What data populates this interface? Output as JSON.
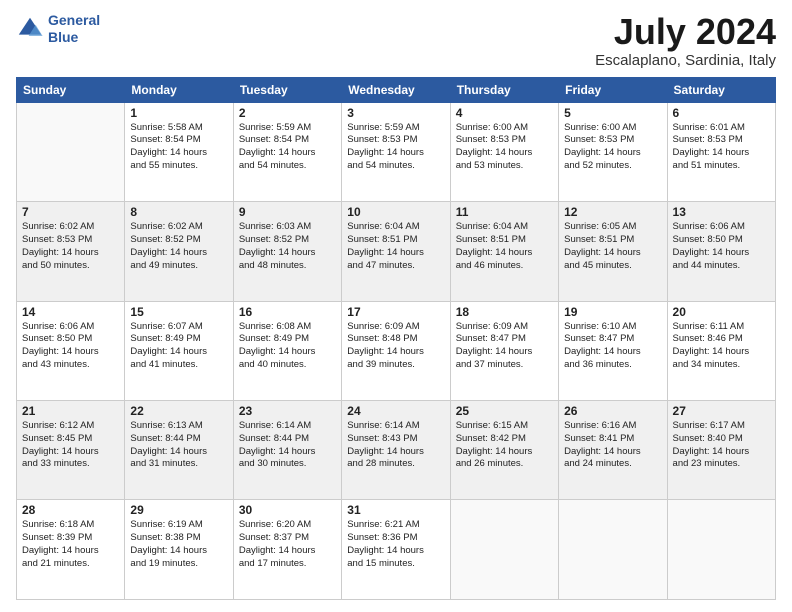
{
  "logo": {
    "line1": "General",
    "line2": "Blue"
  },
  "title": "July 2024",
  "location": "Escalaplano, Sardinia, Italy",
  "headers": [
    "Sunday",
    "Monday",
    "Tuesday",
    "Wednesday",
    "Thursday",
    "Friday",
    "Saturday"
  ],
  "weeks": [
    [
      {
        "day": "",
        "lines": []
      },
      {
        "day": "1",
        "lines": [
          "Sunrise: 5:58 AM",
          "Sunset: 8:54 PM",
          "Daylight: 14 hours",
          "and 55 minutes."
        ]
      },
      {
        "day": "2",
        "lines": [
          "Sunrise: 5:59 AM",
          "Sunset: 8:54 PM",
          "Daylight: 14 hours",
          "and 54 minutes."
        ]
      },
      {
        "day": "3",
        "lines": [
          "Sunrise: 5:59 AM",
          "Sunset: 8:53 PM",
          "Daylight: 14 hours",
          "and 54 minutes."
        ]
      },
      {
        "day": "4",
        "lines": [
          "Sunrise: 6:00 AM",
          "Sunset: 8:53 PM",
          "Daylight: 14 hours",
          "and 53 minutes."
        ]
      },
      {
        "day": "5",
        "lines": [
          "Sunrise: 6:00 AM",
          "Sunset: 8:53 PM",
          "Daylight: 14 hours",
          "and 52 minutes."
        ]
      },
      {
        "day": "6",
        "lines": [
          "Sunrise: 6:01 AM",
          "Sunset: 8:53 PM",
          "Daylight: 14 hours",
          "and 51 minutes."
        ]
      }
    ],
    [
      {
        "day": "7",
        "lines": [
          "Sunrise: 6:02 AM",
          "Sunset: 8:53 PM",
          "Daylight: 14 hours",
          "and 50 minutes."
        ]
      },
      {
        "day": "8",
        "lines": [
          "Sunrise: 6:02 AM",
          "Sunset: 8:52 PM",
          "Daylight: 14 hours",
          "and 49 minutes."
        ]
      },
      {
        "day": "9",
        "lines": [
          "Sunrise: 6:03 AM",
          "Sunset: 8:52 PM",
          "Daylight: 14 hours",
          "and 48 minutes."
        ]
      },
      {
        "day": "10",
        "lines": [
          "Sunrise: 6:04 AM",
          "Sunset: 8:51 PM",
          "Daylight: 14 hours",
          "and 47 minutes."
        ]
      },
      {
        "day": "11",
        "lines": [
          "Sunrise: 6:04 AM",
          "Sunset: 8:51 PM",
          "Daylight: 14 hours",
          "and 46 minutes."
        ]
      },
      {
        "day": "12",
        "lines": [
          "Sunrise: 6:05 AM",
          "Sunset: 8:51 PM",
          "Daylight: 14 hours",
          "and 45 minutes."
        ]
      },
      {
        "day": "13",
        "lines": [
          "Sunrise: 6:06 AM",
          "Sunset: 8:50 PM",
          "Daylight: 14 hours",
          "and 44 minutes."
        ]
      }
    ],
    [
      {
        "day": "14",
        "lines": [
          "Sunrise: 6:06 AM",
          "Sunset: 8:50 PM",
          "Daylight: 14 hours",
          "and 43 minutes."
        ]
      },
      {
        "day": "15",
        "lines": [
          "Sunrise: 6:07 AM",
          "Sunset: 8:49 PM",
          "Daylight: 14 hours",
          "and 41 minutes."
        ]
      },
      {
        "day": "16",
        "lines": [
          "Sunrise: 6:08 AM",
          "Sunset: 8:49 PM",
          "Daylight: 14 hours",
          "and 40 minutes."
        ]
      },
      {
        "day": "17",
        "lines": [
          "Sunrise: 6:09 AM",
          "Sunset: 8:48 PM",
          "Daylight: 14 hours",
          "and 39 minutes."
        ]
      },
      {
        "day": "18",
        "lines": [
          "Sunrise: 6:09 AM",
          "Sunset: 8:47 PM",
          "Daylight: 14 hours",
          "and 37 minutes."
        ]
      },
      {
        "day": "19",
        "lines": [
          "Sunrise: 6:10 AM",
          "Sunset: 8:47 PM",
          "Daylight: 14 hours",
          "and 36 minutes."
        ]
      },
      {
        "day": "20",
        "lines": [
          "Sunrise: 6:11 AM",
          "Sunset: 8:46 PM",
          "Daylight: 14 hours",
          "and 34 minutes."
        ]
      }
    ],
    [
      {
        "day": "21",
        "lines": [
          "Sunrise: 6:12 AM",
          "Sunset: 8:45 PM",
          "Daylight: 14 hours",
          "and 33 minutes."
        ]
      },
      {
        "day": "22",
        "lines": [
          "Sunrise: 6:13 AM",
          "Sunset: 8:44 PM",
          "Daylight: 14 hours",
          "and 31 minutes."
        ]
      },
      {
        "day": "23",
        "lines": [
          "Sunrise: 6:14 AM",
          "Sunset: 8:44 PM",
          "Daylight: 14 hours",
          "and 30 minutes."
        ]
      },
      {
        "day": "24",
        "lines": [
          "Sunrise: 6:14 AM",
          "Sunset: 8:43 PM",
          "Daylight: 14 hours",
          "and 28 minutes."
        ]
      },
      {
        "day": "25",
        "lines": [
          "Sunrise: 6:15 AM",
          "Sunset: 8:42 PM",
          "Daylight: 14 hours",
          "and 26 minutes."
        ]
      },
      {
        "day": "26",
        "lines": [
          "Sunrise: 6:16 AM",
          "Sunset: 8:41 PM",
          "Daylight: 14 hours",
          "and 24 minutes."
        ]
      },
      {
        "day": "27",
        "lines": [
          "Sunrise: 6:17 AM",
          "Sunset: 8:40 PM",
          "Daylight: 14 hours",
          "and 23 minutes."
        ]
      }
    ],
    [
      {
        "day": "28",
        "lines": [
          "Sunrise: 6:18 AM",
          "Sunset: 8:39 PM",
          "Daylight: 14 hours",
          "and 21 minutes."
        ]
      },
      {
        "day": "29",
        "lines": [
          "Sunrise: 6:19 AM",
          "Sunset: 8:38 PM",
          "Daylight: 14 hours",
          "and 19 minutes."
        ]
      },
      {
        "day": "30",
        "lines": [
          "Sunrise: 6:20 AM",
          "Sunset: 8:37 PM",
          "Daylight: 14 hours",
          "and 17 minutes."
        ]
      },
      {
        "day": "31",
        "lines": [
          "Sunrise: 6:21 AM",
          "Sunset: 8:36 PM",
          "Daylight: 14 hours",
          "and 15 minutes."
        ]
      },
      {
        "day": "",
        "lines": []
      },
      {
        "day": "",
        "lines": []
      },
      {
        "day": "",
        "lines": []
      }
    ]
  ]
}
